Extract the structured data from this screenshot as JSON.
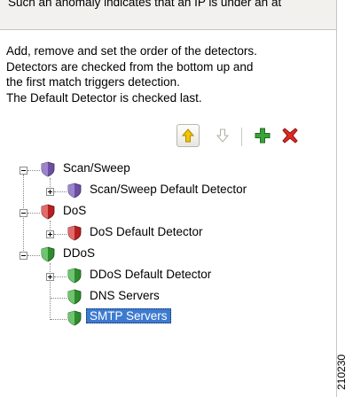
{
  "header": {
    "fragment": "Such an anomaly indicates that an IP is under an at"
  },
  "info": {
    "lines": [
      "Add, remove and set the order of the detectors.",
      "Detectors are checked from the bottom up and",
      "the first match triggers detection.",
      "The Default Detector is checked last."
    ]
  },
  "toolbar": {
    "buttons": [
      {
        "name": "move-up-icon",
        "state": "enabled",
        "color": "#e0a800"
      },
      {
        "name": "move-down-icon",
        "state": "disabled",
        "color": "#b0b0a8"
      },
      {
        "name": "add-icon",
        "state": "enabled",
        "color": "#3aa23a"
      },
      {
        "name": "remove-icon",
        "state": "enabled",
        "color": "#d6241f"
      }
    ]
  },
  "tree": {
    "nodes": [
      {
        "label": "Scan/Sweep",
        "level": 0,
        "expander": "minus",
        "shield_color": "#6d4fa0"
      },
      {
        "label": "Scan/Sweep Default Detector",
        "level": 1,
        "expander": "plus",
        "shield_color": "#6d4fa0"
      },
      {
        "label": "DoS",
        "level": 0,
        "expander": "minus",
        "shield_color": "#b52020"
      },
      {
        "label": "DoS Default Detector",
        "level": 1,
        "expander": "plus",
        "shield_color": "#b52020"
      },
      {
        "label": "DDoS",
        "level": 0,
        "expander": "minus",
        "shield_color": "#2e8b2e"
      },
      {
        "label": "DDoS Default Detector",
        "level": 1,
        "expander": "plus",
        "shield_color": "#2e8b2e"
      },
      {
        "label": "DNS Servers",
        "level": 1,
        "expander": "none",
        "shield_color": "#2e8b2e"
      },
      {
        "label": "SMTP Servers",
        "level": 1,
        "expander": "none",
        "shield_color": "#2e8b2e",
        "selected": true
      }
    ]
  },
  "watermark": "210230",
  "colors": {
    "selection": "#3d7bd0",
    "panel_bg": "#f2f1ee"
  }
}
